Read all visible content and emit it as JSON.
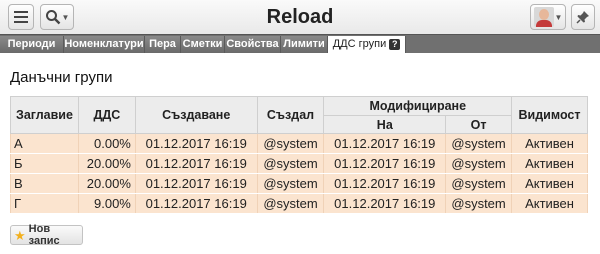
{
  "app": {
    "title": "Reload"
  },
  "tabs": [
    {
      "label": "Периоди"
    },
    {
      "label": "Номенклатури"
    },
    {
      "label": "Пера"
    },
    {
      "label": "Сметки"
    },
    {
      "label": "Свойства"
    },
    {
      "label": "Лимити"
    },
    {
      "label": "ДДС групи",
      "active": true,
      "help": "?"
    }
  ],
  "section": {
    "title": "Данъчни групи"
  },
  "table": {
    "headers": {
      "title": "Заглавие",
      "vat": "ДДС",
      "created": "Създаване",
      "creator": "Създал",
      "modified": "Модифициране",
      "mod_on": "На",
      "mod_by": "От",
      "visibility": "Видимост"
    },
    "rows": [
      {
        "title": "А",
        "vat": "0.00%",
        "created": "01.12.2017 16:19",
        "creator": "@system",
        "mod_on": "01.12.2017 16:19",
        "mod_by": "@system",
        "visibility": "Активен"
      },
      {
        "title": "Б",
        "vat": "20.00%",
        "created": "01.12.2017 16:19",
        "creator": "@system",
        "mod_on": "01.12.2017 16:19",
        "mod_by": "@system",
        "visibility": "Активен"
      },
      {
        "title": "В",
        "vat": "20.00%",
        "created": "01.12.2017 16:19",
        "creator": "@system",
        "mod_on": "01.12.2017 16:19",
        "mod_by": "@system",
        "visibility": "Активен"
      },
      {
        "title": "Г",
        "vat": "9.00%",
        "created": "01.12.2017 16:19",
        "creator": "@system",
        "mod_on": "01.12.2017 16:19",
        "mod_by": "@system",
        "visibility": "Активен"
      }
    ]
  },
  "actions": {
    "new_record": "Нов запис"
  },
  "icons": {
    "menu": "hamburger-menu-icon",
    "search": "search-icon",
    "avatar": "user-avatar",
    "pin": "pin-icon",
    "new": "star-icon"
  },
  "colors": {
    "row_background": "#fbe4cf",
    "header_background": "#ececec",
    "tab_bar": "#707070",
    "star": "#f2b01e"
  }
}
